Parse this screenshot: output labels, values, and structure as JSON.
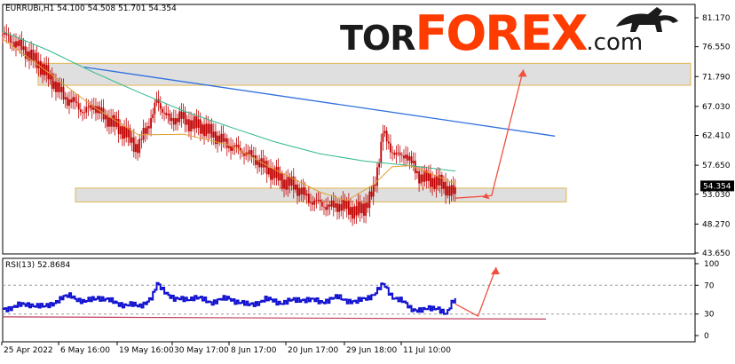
{
  "logo": {
    "part1": "TOR",
    "part2": "FOREX",
    "part3": ".com"
  },
  "colors": {
    "candle": "#c00000",
    "ma_fast": "#e0a030",
    "ma_slow": "#30b890",
    "trend": "#3070e0",
    "forecast": "#f05040",
    "zone_fill": "#dcdcdc",
    "zone_stroke": "#e0b040",
    "rsi_line": "#1010d0",
    "rsi_support": "#c04060"
  },
  "chart_data": [
    {
      "type": "candlestick",
      "title": "EURRUBi,H1  54.100 54.508 51.701 54.354",
      "last_price_label": "54.354",
      "y_ticks": [
        "81.170",
        "76.550",
        "71.790",
        "67.030",
        "62.410",
        "57.650",
        "53.030",
        "48.270",
        "43.650"
      ],
      "ylim": [
        43.65,
        81.17
      ],
      "x_ticks": [
        "25 Apr 2022",
        "6 May 16:00",
        "19 May 16:00",
        "30 May 17:00",
        "8 Jun 17:00",
        "20 Jun 17:00",
        "29 Jun 18:00",
        "11 Jul 10:00"
      ],
      "price_path": [
        [
          0,
          78.5
        ],
        [
          4,
          76.5
        ],
        [
          8,
          73.8
        ],
        [
          11,
          71.0
        ],
        [
          14,
          68.2
        ],
        [
          16,
          67.6
        ],
        [
          18,
          66.0
        ],
        [
          20,
          67.3
        ],
        [
          22,
          65.6
        ],
        [
          24,
          64.6
        ],
        [
          27,
          62.9
        ],
        [
          29,
          61.0
        ],
        [
          30,
          60.3
        ],
        [
          31,
          62.6
        ],
        [
          33,
          65.3
        ],
        [
          34,
          68.0
        ],
        [
          35,
          66.9
        ],
        [
          37,
          64.6
        ],
        [
          39,
          65.5
        ],
        [
          41,
          64.4
        ],
        [
          44,
          63.8
        ],
        [
          47,
          62.3
        ],
        [
          50,
          60.8
        ],
        [
          53,
          59.9
        ],
        [
          56,
          58.6
        ],
        [
          58,
          57.2
        ],
        [
          60,
          56.3
        ],
        [
          62,
          55.0
        ],
        [
          64,
          54.6
        ],
        [
          66,
          53.4
        ],
        [
          68,
          52.0
        ],
        [
          70,
          51.6
        ],
        [
          72,
          51.0
        ],
        [
          74,
          51.3
        ],
        [
          76,
          50.9
        ],
        [
          78,
          50.2
        ],
        [
          80,
          51.0
        ],
        [
          82,
          53.6
        ],
        [
          83,
          58.3
        ],
        [
          84,
          63.0
        ],
        [
          85,
          61.1
        ],
        [
          86,
          60.0
        ],
        [
          88,
          58.8
        ],
        [
          89,
          59.6
        ],
        [
          90,
          58.4
        ],
        [
          91,
          57.0
        ],
        [
          92,
          55.9
        ],
        [
          94,
          55.4
        ],
        [
          96,
          55.0
        ],
        [
          98,
          54.1
        ],
        [
          99,
          53.4
        ],
        [
          100,
          53.2
        ]
      ],
      "ma_fast": [
        [
          0,
          77.8
        ],
        [
          10,
          72.5
        ],
        [
          20,
          67.0
        ],
        [
          30,
          62.5
        ],
        [
          40,
          62.6
        ],
        [
          50,
          60.9
        ],
        [
          60,
          57.0
        ],
        [
          70,
          53.4
        ],
        [
          76,
          52.0
        ],
        [
          82,
          54.6
        ],
        [
          86,
          57.4
        ],
        [
          90,
          57.6
        ],
        [
          95,
          56.2
        ],
        [
          100,
          54.7
        ]
      ],
      "ma_slow": [
        [
          0,
          79.0
        ],
        [
          10,
          76.0
        ],
        [
          20,
          72.5
        ],
        [
          30,
          69.3
        ],
        [
          40,
          66.3
        ],
        [
          50,
          63.8
        ],
        [
          60,
          61.4
        ],
        [
          70,
          59.5
        ],
        [
          80,
          58.3
        ],
        [
          90,
          57.6
        ],
        [
          100,
          56.7
        ]
      ],
      "trendline": [
        [
          18,
          73.3
        ],
        [
          122,
          62.3
        ]
      ],
      "resistance_zone": [
        70.4,
        73.9
      ],
      "support_zone": [
        51.8,
        54.0
      ],
      "forecast": [
        [
          100,
          52.4
        ],
        [
          108,
          52.8
        ],
        [
          115,
          72.9
        ]
      ]
    },
    {
      "type": "line",
      "title": "RSI(13) 52.8684",
      "y_ticks": [
        "100",
        "70",
        "30",
        "0"
      ],
      "ylim": [
        0,
        100
      ],
      "levels": [
        70,
        30
      ],
      "values": [
        [
          0,
          37
        ],
        [
          3,
          41
        ],
        [
          6,
          44
        ],
        [
          9,
          39
        ],
        [
          12,
          49
        ],
        [
          15,
          56
        ],
        [
          18,
          46
        ],
        [
          21,
          54
        ],
        [
          24,
          47
        ],
        [
          27,
          43
        ],
        [
          30,
          41
        ],
        [
          33,
          53
        ],
        [
          34,
          71
        ],
        [
          36,
          61
        ],
        [
          38,
          49
        ],
        [
          42,
          53
        ],
        [
          46,
          47
        ],
        [
          50,
          52
        ],
        [
          54,
          42
        ],
        [
          58,
          50
        ],
        [
          62,
          46
        ],
        [
          66,
          51
        ],
        [
          70,
          47
        ],
        [
          74,
          53
        ],
        [
          78,
          46
        ],
        [
          82,
          58
        ],
        [
          84,
          71
        ],
        [
          86,
          55
        ],
        [
          88,
          48
        ],
        [
          90,
          38
        ],
        [
          93,
          35
        ],
        [
          96,
          40
        ],
        [
          98,
          28
        ],
        [
          99,
          43
        ],
        [
          100,
          52
        ]
      ],
      "support_line": [
        [
          0,
          26
        ],
        [
          120,
          23
        ]
      ],
      "forecast": [
        [
          100,
          44
        ],
        [
          105,
          27
        ],
        [
          109,
          95
        ]
      ]
    }
  ]
}
